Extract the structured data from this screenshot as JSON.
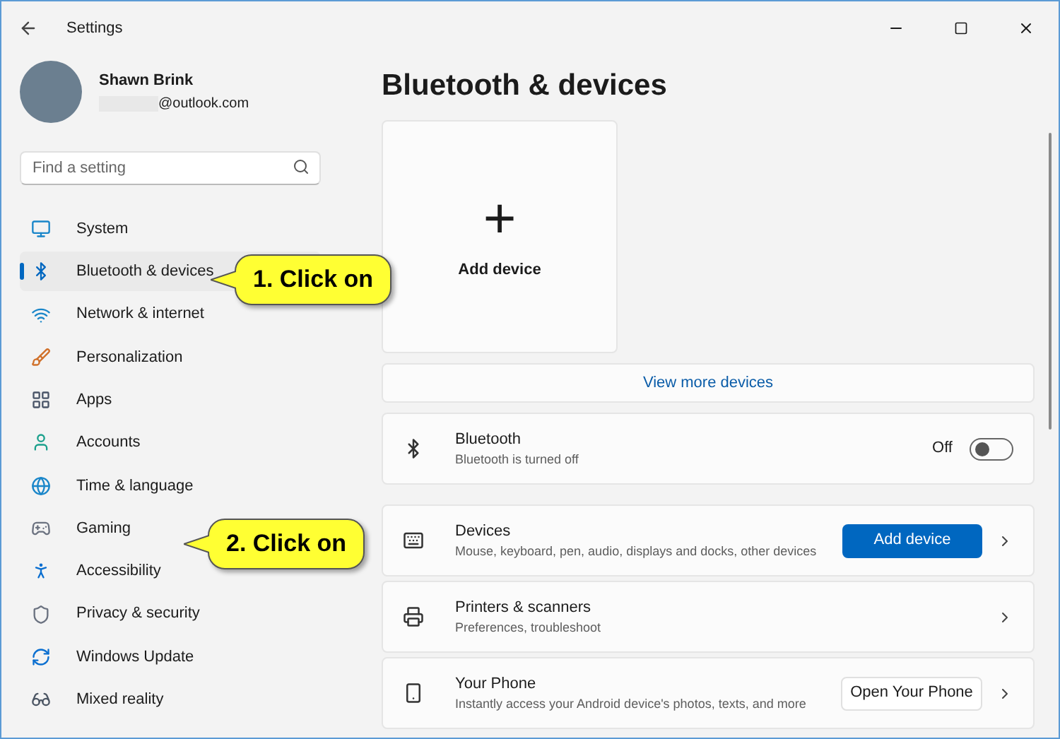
{
  "window": {
    "title": "Settings"
  },
  "user": {
    "name": "Shawn Brink",
    "email": "@outlook.com"
  },
  "search": {
    "placeholder": "Find a setting"
  },
  "nav": [
    {
      "label": "System",
      "selected": false
    },
    {
      "label": "Bluetooth & devices",
      "selected": true
    },
    {
      "label": "Network & internet",
      "selected": false
    },
    {
      "label": "Personalization",
      "selected": false
    },
    {
      "label": "Apps",
      "selected": false
    },
    {
      "label": "Accounts",
      "selected": false
    },
    {
      "label": "Time & language",
      "selected": false
    },
    {
      "label": "Gaming",
      "selected": false
    },
    {
      "label": "Accessibility",
      "selected": false
    },
    {
      "label": "Privacy & security",
      "selected": false
    },
    {
      "label": "Windows Update",
      "selected": false
    },
    {
      "label": "Mixed reality",
      "selected": false
    }
  ],
  "page": {
    "title": "Bluetooth & devices",
    "add_tile": {
      "icon": "+",
      "label": "Add device"
    },
    "view_more": "View more devices"
  },
  "cards": [
    {
      "kind": "toggle",
      "title": "Bluetooth",
      "subtitle": "Bluetooth is turned off",
      "state_label": "Off",
      "on": false
    },
    {
      "kind": "primary",
      "title": "Devices",
      "subtitle": "Mouse, keyboard, pen, audio, displays and docks, other devices",
      "button": "Add device"
    },
    {
      "kind": "link",
      "title": "Printers & scanners",
      "subtitle": "Preferences, troubleshoot"
    },
    {
      "kind": "secondary",
      "title": "Your Phone",
      "subtitle": "Instantly access your Android device's photos, texts, and more",
      "button": "Open Your Phone"
    }
  ],
  "callouts": [
    {
      "text": "1. Click on"
    },
    {
      "text": "2. Click on"
    }
  ]
}
